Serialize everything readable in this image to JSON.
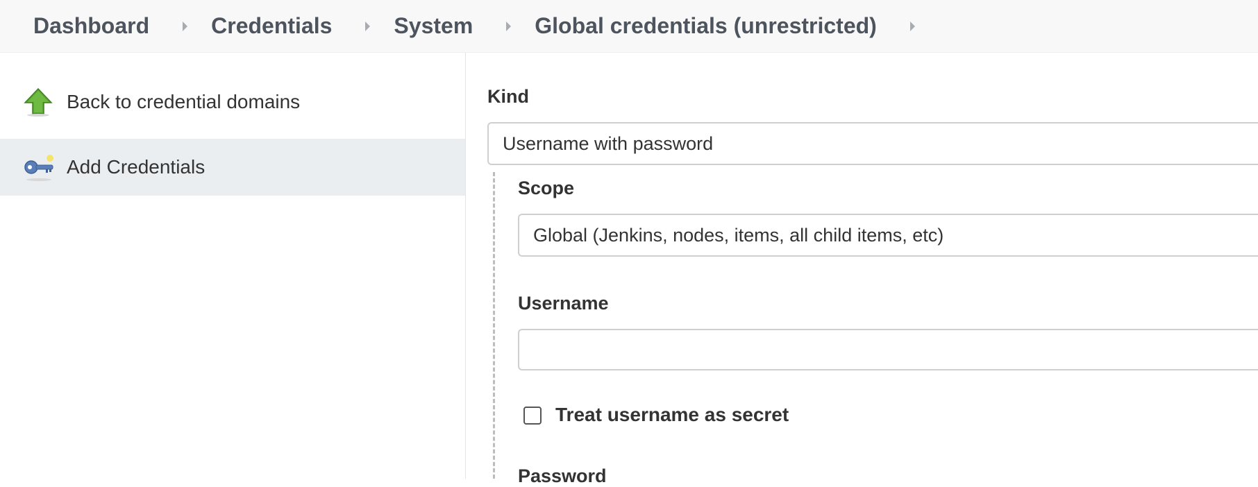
{
  "breadcrumbs": [
    {
      "label": "Dashboard"
    },
    {
      "label": "Credentials"
    },
    {
      "label": "System"
    },
    {
      "label": "Global credentials (unrestricted)"
    }
  ],
  "sidebar": {
    "items": [
      {
        "label": "Back to credential domains",
        "icon": "up-arrow-icon",
        "active": false
      },
      {
        "label": "Add Credentials",
        "icon": "key-icon",
        "active": true
      }
    ]
  },
  "form": {
    "kind": {
      "label": "Kind",
      "value": "Username with password"
    },
    "scope": {
      "label": "Scope",
      "value": "Global (Jenkins, nodes, items, all child items, etc)"
    },
    "username": {
      "label": "Username",
      "value": ""
    },
    "treat_username_secret": {
      "label": "Treat username as secret",
      "checked": false
    },
    "password": {
      "label": "Password"
    }
  },
  "colors": {
    "breadcrumb_bg": "#f8f8f8",
    "breadcrumb_text": "#4d545d",
    "sidebar_active_bg": "#ebeef1",
    "arrow_green": "#5aa832",
    "key_blue": "#5a7fb8"
  }
}
